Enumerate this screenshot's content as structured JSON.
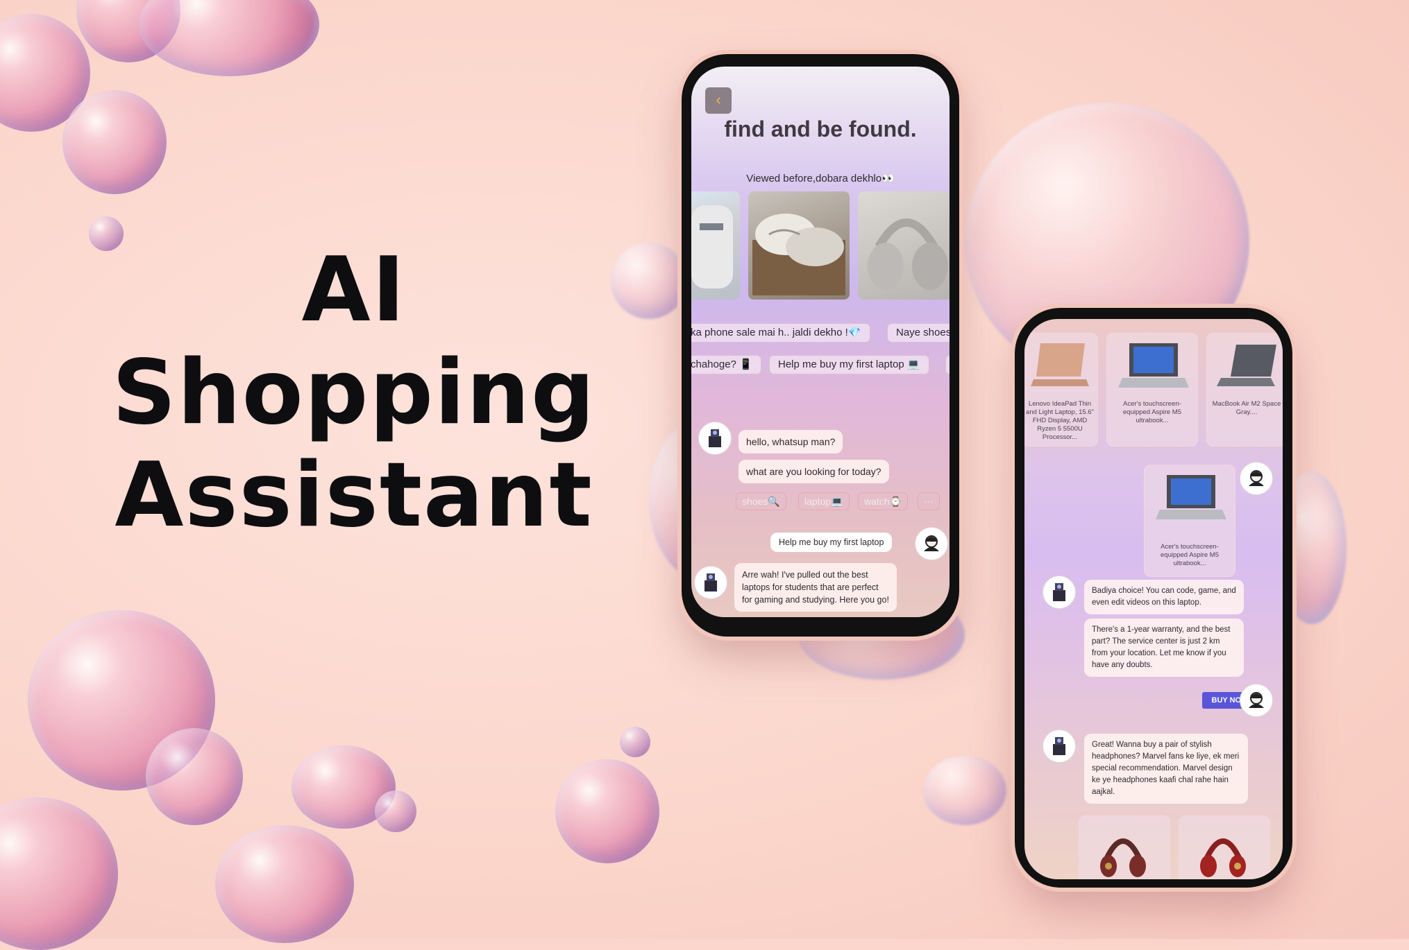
{
  "headline": {
    "line1": "AI",
    "line2": "Shopping",
    "line3": "Assistant"
  },
  "phone_left": {
    "back_icon": "chevron-left-icon",
    "back_glyph": "‹",
    "title": "find and be found.",
    "viewed_label": "Viewed before,dobara dekhlo👀",
    "suggestions_row1": [
      "ka phone sale mai h.. jaldi dekho !💎",
      "Naye shoes"
    ],
    "suggestions_row2": [
      "chahoge? 📱",
      "Help me buy my first laptop 💻",
      ""
    ],
    "chat": {
      "bot_msg1": "hello, whatsup man?",
      "bot_msg2": "what are you looking for today?",
      "quick_replies": [
        "shoes🔍",
        "laptop💻",
        "watch⌚",
        "⋯"
      ],
      "user_msg": "Help me buy my first laptop",
      "bot_msg3": "Arre wah! I've pulled out the best laptops for students that are perfect for gaming and studying. Here you go!"
    }
  },
  "phone_right": {
    "products": [
      {
        "caption": "Lenovo IdeaPad Thin and Light Laptop, 15.6\" FHD Display, AMD Ryzen 5 5500U Processor..."
      },
      {
        "caption": "Acer's touchscreen-equipped Aspire M5 ultrabook..."
      },
      {
        "caption": "MacBook Air M2 Space Gray...."
      }
    ],
    "selected_product": {
      "caption": "Acer's touchscreen-equipped Aspire M5 ultrabook..."
    },
    "bot_msg1": "Badiya choice! You can code, game, and even edit videos on this laptop.",
    "bot_msg2": "There's a 1-year warranty, and the best part? The service center is just 2 km from your location. Let me know if you have any doubts.",
    "buy_now": "BUY NOW",
    "bot_msg3": "Great! Wanna buy a pair of stylish headphones? Marvel fans ke liye, ek meri special recommendation. Marvel design ke ye headphones kaafi chal rahe hain aajkal."
  },
  "colors": {
    "background": "#fcd6cc",
    "accent": "#5a55d8",
    "headline": "#0e0e10"
  }
}
